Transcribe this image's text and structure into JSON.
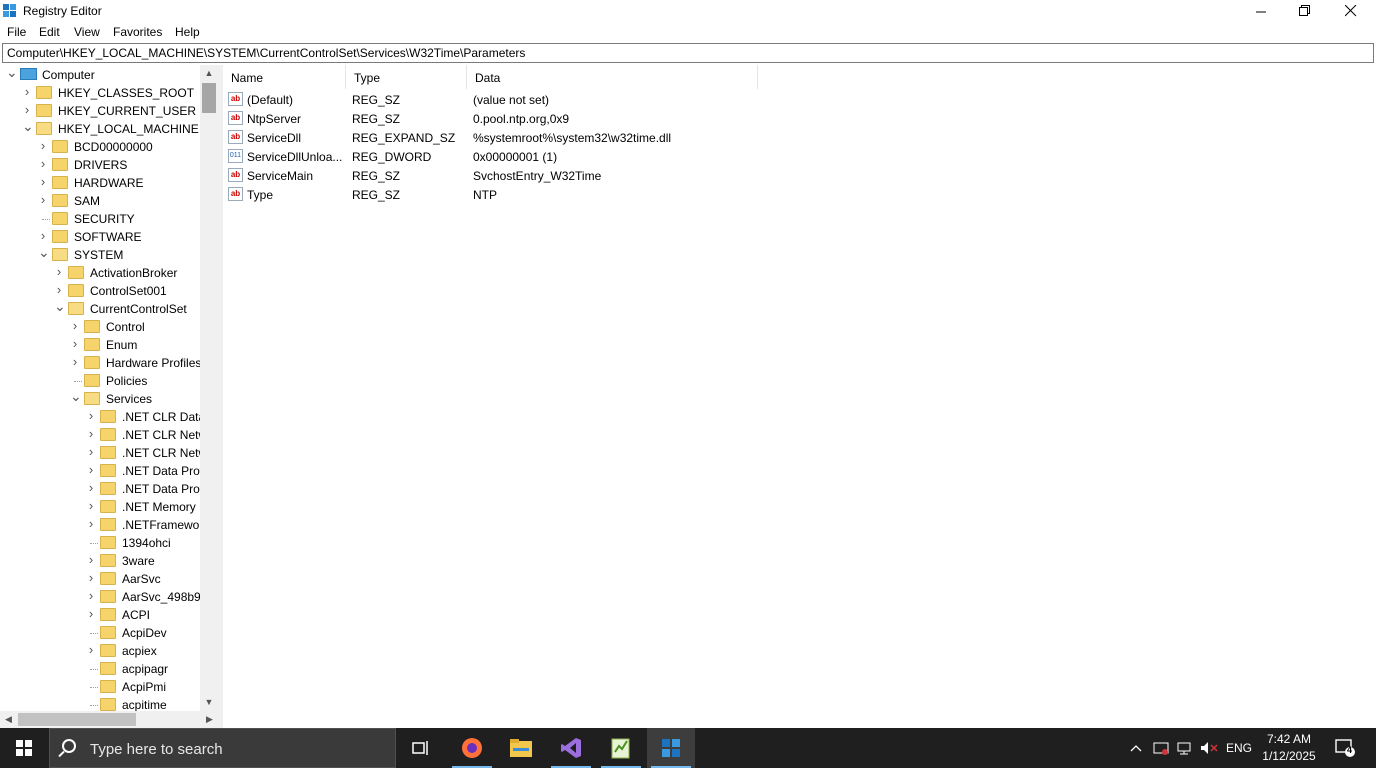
{
  "window": {
    "title": "Registry Editor",
    "minimize_glyph": "🗕",
    "restore_glyph": "🗗",
    "close_glyph": "✕"
  },
  "menu": [
    "File",
    "Edit",
    "View",
    "Favorites",
    "Help"
  ],
  "address": "Computer\\HKEY_LOCAL_MACHINE\\SYSTEM\\CurrentControlSet\\Services\\W32Time\\Parameters",
  "tree": [
    {
      "label": "Computer",
      "depth": 0,
      "state": "expanded",
      "icon": "computer-icon"
    },
    {
      "label": "HKEY_CLASSES_ROOT",
      "depth": 1,
      "state": "collapsed"
    },
    {
      "label": "HKEY_CURRENT_USER",
      "depth": 1,
      "state": "collapsed"
    },
    {
      "label": "HKEY_LOCAL_MACHINE",
      "depth": 1,
      "state": "expanded"
    },
    {
      "label": "BCD00000000",
      "depth": 2,
      "state": "collapsed"
    },
    {
      "label": "DRIVERS",
      "depth": 2,
      "state": "collapsed"
    },
    {
      "label": "HARDWARE",
      "depth": 2,
      "state": "collapsed"
    },
    {
      "label": "SAM",
      "depth": 2,
      "state": "collapsed"
    },
    {
      "label": "SECURITY",
      "depth": 2,
      "state": "leaf"
    },
    {
      "label": "SOFTWARE",
      "depth": 2,
      "state": "collapsed"
    },
    {
      "label": "SYSTEM",
      "depth": 2,
      "state": "expanded"
    },
    {
      "label": "ActivationBroker",
      "depth": 3,
      "state": "collapsed"
    },
    {
      "label": "ControlSet001",
      "depth": 3,
      "state": "collapsed"
    },
    {
      "label": "CurrentControlSet",
      "depth": 3,
      "state": "expanded"
    },
    {
      "label": "Control",
      "depth": 4,
      "state": "collapsed"
    },
    {
      "label": "Enum",
      "depth": 4,
      "state": "collapsed"
    },
    {
      "label": "Hardware Profiles",
      "depth": 4,
      "state": "collapsed"
    },
    {
      "label": "Policies",
      "depth": 4,
      "state": "leaf"
    },
    {
      "label": "Services",
      "depth": 4,
      "state": "expanded"
    },
    {
      "label": ".NET CLR Data",
      "depth": 5,
      "state": "collapsed"
    },
    {
      "label": ".NET CLR Netw",
      "depth": 5,
      "state": "collapsed"
    },
    {
      "label": ".NET CLR Netw",
      "depth": 5,
      "state": "collapsed"
    },
    {
      "label": ".NET Data Prov",
      "depth": 5,
      "state": "collapsed"
    },
    {
      "label": ".NET Data Prov",
      "depth": 5,
      "state": "collapsed"
    },
    {
      "label": ".NET Memory",
      "depth": 5,
      "state": "collapsed"
    },
    {
      "label": ".NETFramewor",
      "depth": 5,
      "state": "collapsed"
    },
    {
      "label": "1394ohci",
      "depth": 5,
      "state": "leaf"
    },
    {
      "label": "3ware",
      "depth": 5,
      "state": "collapsed"
    },
    {
      "label": "AarSvc",
      "depth": 5,
      "state": "collapsed"
    },
    {
      "label": "AarSvc_498b9",
      "depth": 5,
      "state": "collapsed"
    },
    {
      "label": "ACPI",
      "depth": 5,
      "state": "collapsed"
    },
    {
      "label": "AcpiDev",
      "depth": 5,
      "state": "leaf"
    },
    {
      "label": "acpiex",
      "depth": 5,
      "state": "collapsed"
    },
    {
      "label": "acpipagr",
      "depth": 5,
      "state": "leaf"
    },
    {
      "label": "AcpiPmi",
      "depth": 5,
      "state": "leaf"
    },
    {
      "label": "acpitime",
      "depth": 5,
      "state": "leaf"
    }
  ],
  "list": {
    "columns": [
      "Name",
      "Type",
      "Data"
    ],
    "rows": [
      {
        "icon": "ab",
        "kind": "str",
        "name": "(Default)",
        "type": "REG_SZ",
        "data": "(value not set)"
      },
      {
        "icon": "ab",
        "kind": "str",
        "name": "NtpServer",
        "type": "REG_SZ",
        "data": "0.pool.ntp.org,0x9"
      },
      {
        "icon": "ab",
        "kind": "str",
        "name": "ServiceDll",
        "type": "REG_EXPAND_SZ",
        "data": "%systemroot%\\system32\\w32time.dll"
      },
      {
        "icon": "011",
        "kind": "bin",
        "name": "ServiceDllUnloa...",
        "type": "REG_DWORD",
        "data": "0x00000001 (1)"
      },
      {
        "icon": "ab",
        "kind": "str",
        "name": "ServiceMain",
        "type": "REG_SZ",
        "data": "SvchostEntry_W32Time"
      },
      {
        "icon": "ab",
        "kind": "str",
        "name": "Type",
        "type": "REG_SZ",
        "data": "NTP"
      }
    ]
  },
  "taskbar": {
    "search_placeholder": "Type here to search",
    "apps": [
      "task-view-icon",
      "firefox-icon",
      "file-explorer-icon",
      "visual-studio-icon",
      "notepad-plus-icon",
      "registry-editor-icon"
    ],
    "tray": {
      "chevron": "^",
      "language": "ENG",
      "time": "7:42 AM",
      "date": "1/12/2025",
      "notification_count": "4"
    }
  }
}
